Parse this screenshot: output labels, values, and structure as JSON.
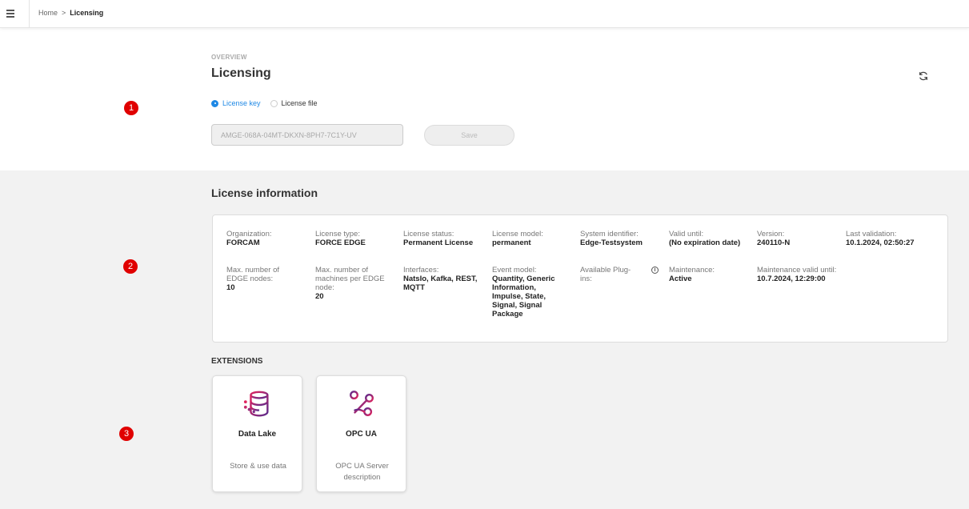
{
  "breadcrumb": {
    "home": "Home",
    "separator": ">",
    "current": "Licensing"
  },
  "header": {
    "overview_label": "OVERVIEW",
    "title": "Licensing"
  },
  "license_source": {
    "options": [
      {
        "label": "License key",
        "selected": true
      },
      {
        "label": "License file",
        "selected": false
      }
    ],
    "key_value": "AMGE-068A-04MT-DKXN-8PH7-7C1Y-UV",
    "save_label": "Save"
  },
  "markers": [
    "1",
    "2",
    "3"
  ],
  "license_info": {
    "title": "License information",
    "fields": [
      {
        "label": "Organization:",
        "value": "FORCAM"
      },
      {
        "label": "License type:",
        "value": "FORCE EDGE"
      },
      {
        "label": "License status:",
        "value": "Permanent License"
      },
      {
        "label": "License model:",
        "value": "permanent"
      },
      {
        "label": "System identifier:",
        "value": "Edge-Testsystem"
      },
      {
        "label": "Valid until:",
        "value": "(No expiration date)"
      },
      {
        "label": "Version:",
        "value": "240110-N"
      },
      {
        "label": "Last validation:",
        "value": "10.1.2024, 02:50:27"
      },
      {
        "label": "Max. number of EDGE nodes:",
        "value": "10"
      },
      {
        "label": "Max. number of machines per EDGE node:",
        "value": "20"
      },
      {
        "label": "Interfaces:",
        "value": "NatsIo, Kafka, REST, MQTT"
      },
      {
        "label": "Event model:",
        "value": "Quantity, Generic Information, Impulse, State, Signal, Signal Package"
      },
      {
        "label": "Available Plug-ins:",
        "value": ""
      },
      {
        "label": "Maintenance:",
        "value": "Active"
      },
      {
        "label": "Maintenance valid until:",
        "value": "10.7.2024, 12:29:00"
      }
    ]
  },
  "extensions": {
    "title": "EXTENSIONS",
    "items": [
      {
        "name": "Data Lake",
        "description": "Store & use data",
        "icon": "database-icon"
      },
      {
        "name": "OPC UA",
        "description": "OPC UA Server description",
        "icon": "connection-nodes-icon"
      }
    ]
  },
  "colors": {
    "accent": "#1e88e5",
    "marker": "#e00000",
    "icon_gradient_start": "#e0245e",
    "icon_gradient_end": "#5b2b8c"
  }
}
